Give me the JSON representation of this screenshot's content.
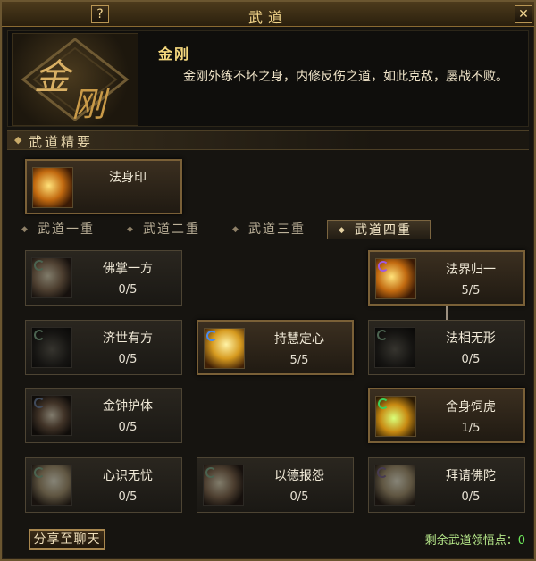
{
  "window": {
    "title": "武道"
  },
  "header": {
    "title": "金刚",
    "description": "金刚外练不坏之身，内修反伤之道，如此克敌，屡战不败。",
    "logo_text": "金刚"
  },
  "section": {
    "label": "武道精要"
  },
  "essence_skill": {
    "name": "法身印",
    "icon": "flame-hand-icon"
  },
  "tabs": [
    {
      "label": "武道一重",
      "selected": false
    },
    {
      "label": "武道二重",
      "selected": false
    },
    {
      "label": "武道三重",
      "selected": false
    },
    {
      "label": "武道四重",
      "selected": true
    }
  ],
  "skills": [
    {
      "name": "佛掌一方",
      "level": "0/5",
      "icon": "palm-icon"
    },
    {
      "name": "法界归一",
      "level": "5/5",
      "icon": "dharma-realm-icon"
    },
    {
      "name": "济世有方",
      "level": "0/5",
      "icon": "swastika-icon"
    },
    {
      "name": "持慧定心",
      "level": "5/5",
      "icon": "meditation-icon"
    },
    {
      "name": "法相无形",
      "level": "0/5",
      "icon": "form-icon"
    },
    {
      "name": "金钟护体",
      "level": "0/5",
      "icon": "golden-bell-icon"
    },
    {
      "name": "舍身饲虎",
      "level": "1/5",
      "icon": "sacrifice-icon"
    },
    {
      "name": "心识无忧",
      "level": "0/5",
      "icon": "mind-icon"
    },
    {
      "name": "以德报怨",
      "level": "0/5",
      "icon": "virtue-icon"
    },
    {
      "name": "拜请佛陀",
      "level": "0/5",
      "icon": "buddha-icon"
    }
  ],
  "footer": {
    "share_label": "分享至聊天",
    "points_label": "剩余武道领悟点：",
    "points_value": "0"
  },
  "colors": {
    "accent": "#f4d77d",
    "frame": "#7a6037",
    "points": "#6ee85a"
  }
}
